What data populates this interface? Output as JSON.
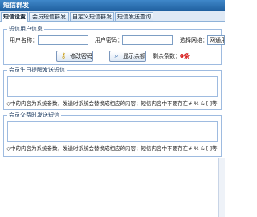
{
  "window": {
    "title": "短信群发"
  },
  "tabs": [
    {
      "label": "短信设置"
    },
    {
      "label": "会员短信群发"
    },
    {
      "label": "自定义短信群发"
    },
    {
      "label": "短信发送查询"
    }
  ],
  "user_info": {
    "title": "短信用户信息",
    "username_label": "用户名称：",
    "username_value": "",
    "password_label": "用户密码：",
    "password_value": "",
    "gateway_label": "选择网络：",
    "gateway_value": "网通用",
    "change_password_button": "修改密码",
    "show_balance_button": "显示余额",
    "balance_label": "剩余条数：",
    "balance_value": "0条"
  },
  "birthday_section": {
    "title": "会员生日提醒发送短信",
    "hint": "◇中的内容为系统参数，发送时系统会替换成相应的内容；短信内容中不要存在# % & [ ]等",
    "message": ""
  },
  "consume_section": {
    "title": "会员交费时发送短信",
    "hint": "◇中的内容为系统参数，发送时系统会替换成相应的内容；短信内容中不要存在# % & [ ]等",
    "message": ""
  },
  "colors": {
    "titlebar": "#2f76bb",
    "tab_bar": "#dfe9f5",
    "border": "#9ebbe0",
    "balance_red": "#d20000"
  },
  "icons": {
    "change_password": "key-icon",
    "show_balance": "magnifier-icon"
  }
}
